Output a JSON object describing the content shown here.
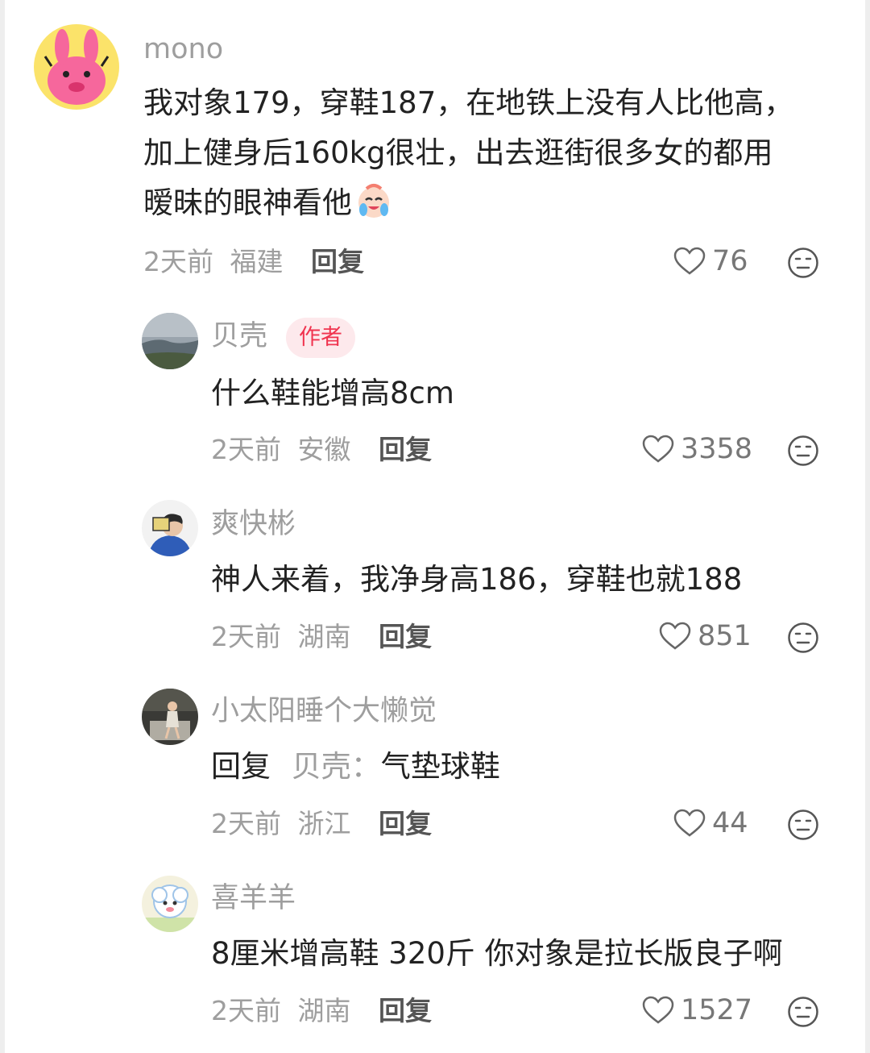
{
  "comments": [
    {
      "username": "mono",
      "text": "我对象179，穿鞋187，在地铁上没有人比他高，加上健身后160kg很壮，出去逛街很多女的都用暧昧的眼神看他",
      "text_lines": [
        "我对象179，穿鞋187，在地铁上没有人比他高，",
        "加上健身后160kg很壮，出去逛街很多女的都用",
        "暧昧的眼神看他"
      ],
      "emoji": "laugh-cry-sticker",
      "time": "2天前",
      "location": "福建",
      "reply_label": "回复",
      "likes": "76"
    },
    {
      "username": "贝壳",
      "badge": "作者",
      "text": "什么鞋能增高8cm",
      "time": "2天前",
      "location": "安徽",
      "reply_label": "回复",
      "likes": "3358"
    },
    {
      "username": "爽快彬",
      "text": "神人来着，我净身高186，穿鞋也就188",
      "time": "2天前",
      "location": "湖南",
      "reply_label": "回复",
      "likes": "851"
    },
    {
      "username": "小太阳睡个大懒觉",
      "reply_prefix": "回复",
      "reply_target": "贝壳：",
      "text": "气垫球鞋",
      "time": "2天前",
      "location": "浙江",
      "reply_label": "回复",
      "likes": "44"
    },
    {
      "username": "喜羊羊",
      "text": "8厘米增高鞋 320斤 你对象是拉长版良子啊",
      "time": "2天前",
      "location": "湖南",
      "reply_label": "回复",
      "likes": "1527"
    }
  ],
  "icons": {
    "like": "heart-outline-icon",
    "dislike": "meh-face-icon"
  },
  "colors": {
    "badge_bg": "#fde9ec",
    "badge_text": "#f0344f",
    "meta_text": "#9e9e9e"
  }
}
